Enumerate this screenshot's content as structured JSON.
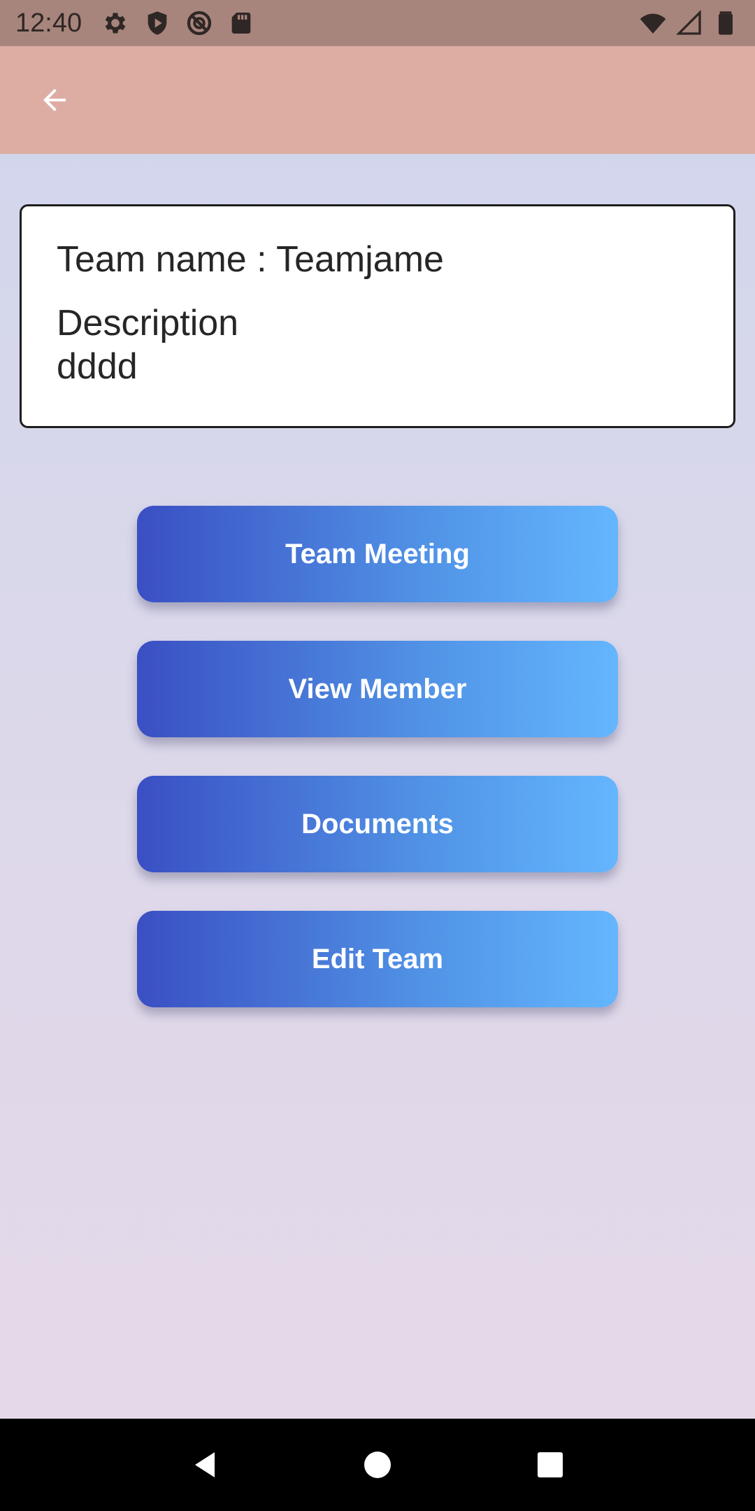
{
  "status_bar": {
    "time": "12:40",
    "icons_left": [
      "gear-icon",
      "shield-icon",
      "do-not-disturb-icon",
      "sd-card-icon"
    ],
    "icons_right": [
      "wifi-icon",
      "cell-signal-icon",
      "battery-icon"
    ],
    "background": "#a7857c"
  },
  "app_bar": {
    "background": "#ddada4",
    "back_icon": "arrow-left-icon"
  },
  "team_card": {
    "team_name_line": "Team name : Teamjame",
    "description_label": "Description",
    "description_value": "dddd"
  },
  "actions": [
    {
      "label": "Team Meeting"
    },
    {
      "label": "View Member"
    },
    {
      "label": "Documents"
    },
    {
      "label": "Edit Team"
    }
  ],
  "button_gradient": [
    "#3a4fc3",
    "#64b6fe"
  ],
  "nav_bar": {
    "icons": [
      "back-triangle-icon",
      "home-circle-icon",
      "recents-square-icon"
    ]
  }
}
